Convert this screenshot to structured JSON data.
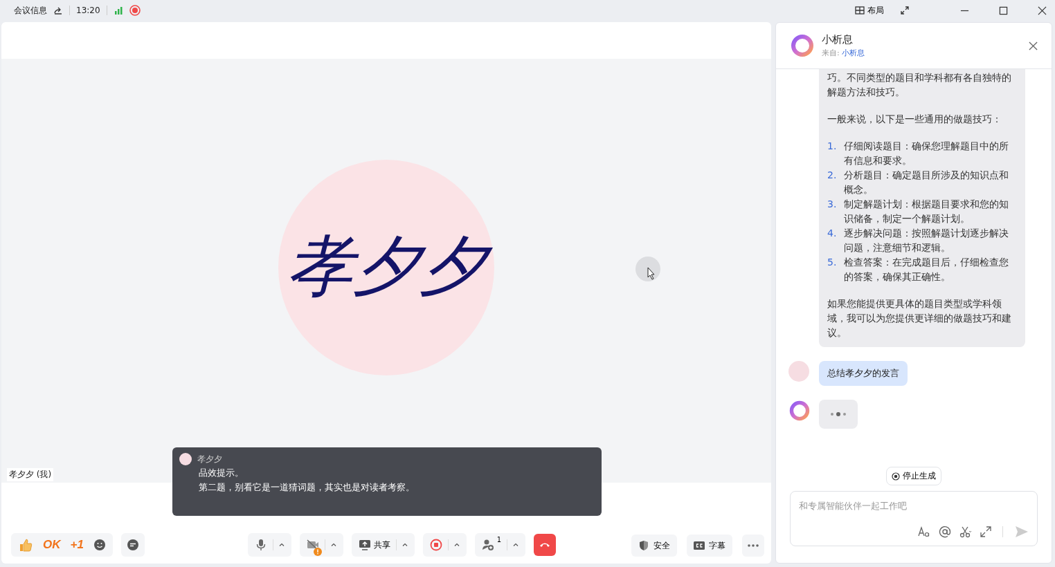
{
  "top_bar": {
    "meeting_info": "会议信息",
    "time": "13:20",
    "recording": true,
    "layout_label": "布局"
  },
  "video": {
    "avatar_text": "孝夕夕",
    "name_tag": "孝夕夕 (我)"
  },
  "caption": {
    "speaker": "孝夕夕",
    "lines": [
      "品效提示。",
      "第二题，别看它是一道猜词题，其实也是对读者考察。"
    ]
  },
  "reactions": [
    {
      "kind": "thumb"
    },
    {
      "kind": "text",
      "label": "OK"
    },
    {
      "kind": "text",
      "label": "+1"
    },
    {
      "kind": "emoji"
    }
  ],
  "controls": [
    {
      "kind": "mic"
    },
    {
      "kind": "camera"
    },
    {
      "kind": "share",
      "label": "共享"
    },
    {
      "kind": "record"
    },
    {
      "kind": "participants",
      "count": "1"
    },
    {
      "kind": "hangup"
    }
  ],
  "right_controls": [
    {
      "kind": "security",
      "label": "安全"
    },
    {
      "kind": "captions",
      "label": "字幕"
    },
    {
      "kind": "more"
    }
  ],
  "assistant": {
    "name": "小析息",
    "source_label": "来自:",
    "source_name": "小析息",
    "messages": [
      {
        "kind": "reply",
        "blocks": [
          {
            "kind": "para",
            "text": "巧。不同类型的题目和学科都有各自独特的解题方法和技巧。"
          },
          {
            "kind": "para",
            "text": "一般来说，以下是一些通用的做题技巧："
          },
          {
            "kind": "list",
            "items": [
              {
                "number": "1.",
                "text": "仔细阅读题目：确保您理解题目中的所有信息和要求。"
              },
              {
                "number": "2.",
                "text": "分析题目：确定题目所涉及的知识点和概念。"
              },
              {
                "number": "3.",
                "text": "制定解题计划：根据题目要求和您的知识储备，制定一个解题计划。"
              },
              {
                "number": "4.",
                "text": "逐步解决问题：按照解题计划逐步解决问题，注意细节和逻辑。"
              },
              {
                "number": "5.",
                "text": "检查答案：在完成题目后，仔细检查您的答案，确保其正确性。"
              }
            ]
          },
          {
            "kind": "para",
            "text": "如果您能提供更具体的题目类型或学科领域，我可以为您提供更详细的做题技巧和建议。"
          }
        ]
      },
      {
        "kind": "user",
        "text": "总结孝夕夕的发言"
      },
      {
        "kind": "typing"
      }
    ],
    "stop_button": "停止生成",
    "input": {
      "placeholder": "和专属智能伙伴一起工作吧"
    }
  }
}
